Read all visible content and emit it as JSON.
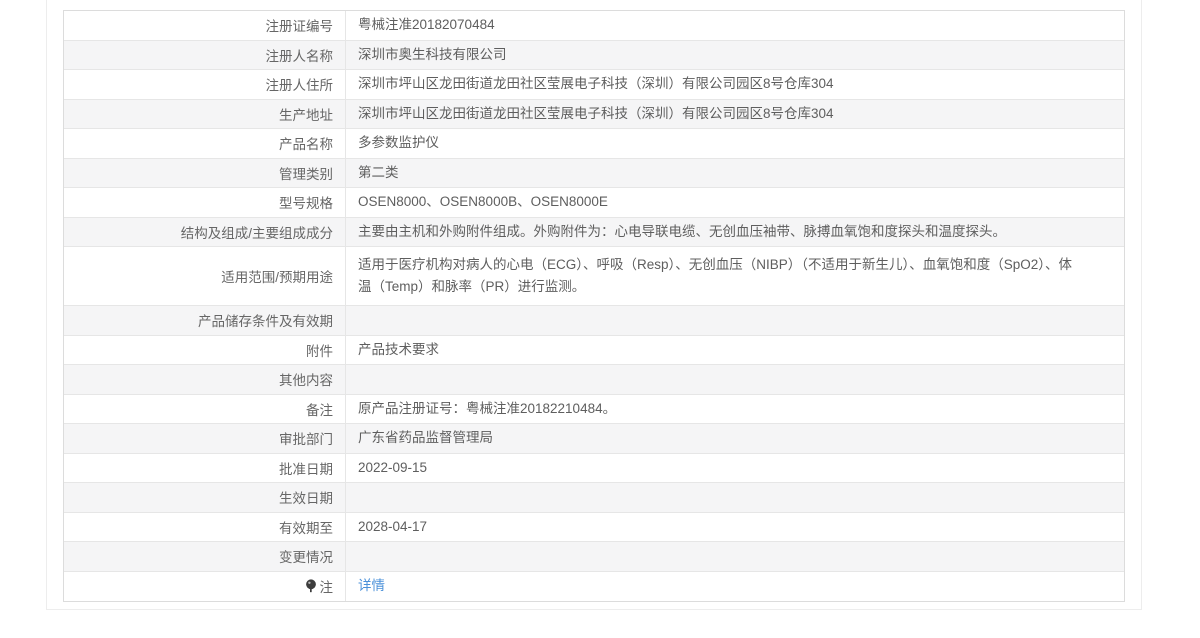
{
  "colors": {
    "row_bg": "#ffffff",
    "row_alt_bg": "#f5f5f6",
    "row_border": "#e6e6e6",
    "table_border": "#dcdcdc",
    "outer_border": "#ededed",
    "label_text": "#666666",
    "value_text": "#5e5e5e",
    "link": "#4a90d9",
    "pin_icon": "#3d3d3d"
  },
  "table": {
    "rows": [
      {
        "label": "注册证编号",
        "value": "粤械注准20182070484"
      },
      {
        "label": "注册人名称",
        "value": "深圳市奥生科技有限公司"
      },
      {
        "label": "注册人住所",
        "value": "深圳市坪山区龙田街道龙田社区莹展电子科技（深圳）有限公司园区8号仓库304"
      },
      {
        "label": "生产地址",
        "value": "深圳市坪山区龙田街道龙田社区莹展电子科技（深圳）有限公司园区8号仓库304"
      },
      {
        "label": "产品名称",
        "value": "多参数监护仪"
      },
      {
        "label": "管理类别",
        "value": "第二类"
      },
      {
        "label": "型号规格",
        "value": "OSEN8000、OSEN8000B、OSEN8000E"
      },
      {
        "label": "结构及组成/主要组成成分",
        "value": "主要由主机和外购附件组成。外购附件为：心电导联电缆、无创血压袖带、脉搏血氧饱和度探头和温度探头。"
      },
      {
        "label": "适用范围/预期用途",
        "value": "适用于医疗机构对病人的心电（ECG）、呼吸（Resp）、无创血压（NIBP）（不适用于新生儿）、血氧饱和度（SpO2）、体温（Temp）和脉率（PR）进行监测。",
        "tall": true
      },
      {
        "label": "产品储存条件及有效期",
        "value": ""
      },
      {
        "label": "附件",
        "value": "产品技术要求"
      },
      {
        "label": "其他内容",
        "value": ""
      },
      {
        "label": "备注",
        "value": "原产品注册证号：粤械注准20182210484。"
      },
      {
        "label": "审批部门",
        "value": "广东省药品监督管理局"
      },
      {
        "label": "批准日期",
        "value": "2022-09-15"
      },
      {
        "label": "生效日期",
        "value": ""
      },
      {
        "label": "有效期至",
        "value": "2028-04-17"
      },
      {
        "label": "变更情况",
        "value": ""
      },
      {
        "label": "注",
        "value": "详情",
        "label_icon": "pin-icon",
        "value_type": "link"
      }
    ]
  }
}
